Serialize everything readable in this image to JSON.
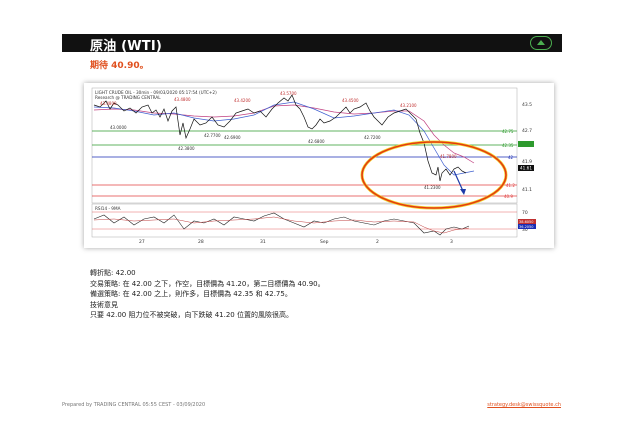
{
  "header": {
    "title": "原油 (WTI)",
    "button_icon": "chevron-up-icon",
    "accent": "#4caf50"
  },
  "subtitle": "期待 40.90。",
  "chart": {
    "title_line1": "LIGHT CRUDE OIL - 30min - 09/03/2020 05:17:54 (UTC+2)",
    "title_line2": "Research @ TRADING CENTRAL",
    "indicator_label": "RSI14 - 9MA",
    "price_labels": [
      "43.5700",
      "43.4800",
      "43.4200",
      "43.4500",
      "43.2100",
      "43.0000",
      "42.7700",
      "42.7800",
      "42.7200",
      "42.6900",
      "42.6800",
      "42.3800",
      "41.7800",
      "41.2300"
    ],
    "y_ticks": [
      "43.5",
      "42.7",
      "41.9",
      "41.1"
    ],
    "level_tags": [
      "42.75",
      "42.35",
      "42",
      "41.2",
      "40.9"
    ],
    "current_tag": "41.61",
    "rsi_ticks": [
      "70",
      "30"
    ],
    "rsi_tags": [
      "38.6050",
      "36.2050"
    ],
    "x_labels": [
      "27",
      "28",
      "31",
      "Sep",
      "2",
      "3"
    ],
    "colors": {
      "support": "#2e9a2e",
      "pivot": "#1a2db5",
      "resistance": "#e04040",
      "ellipse": "#e43a10",
      "ellipse_outer": "#f2d22a",
      "arrow": "#1d3aa8"
    }
  },
  "body": {
    "pivot": "轉折點: 42.00",
    "strategy": "交易策略: 在 42.00 之下，作空，目標價為 41.20，第二目標價為 40.90。",
    "alternative": "備選策略: 在 42.00 之上，則作多，目標價為 42.35 和 42.75。",
    "comment_title": "技術意見",
    "comment": "只要 42.00 阻力位不被突破，向下跌破 41.20 位置的風險很高。"
  },
  "footer": {
    "left": "Prepared by TRADING CENTRAL      05:55 CEST - 03/09/2020",
    "right": "strategy.desk@swissquote.ch"
  }
}
